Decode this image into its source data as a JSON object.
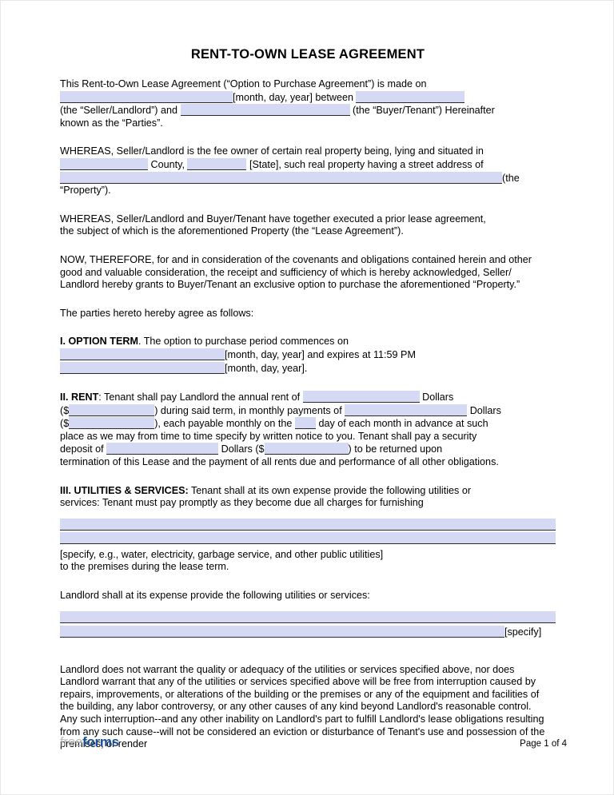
{
  "document": {
    "title": "RENT-TO-OWN LEASE AGREEMENT",
    "intro": {
      "line1": "This Rent-to-Own Lease Agreement (“Option to Purchase Agreement”) is made on",
      "date_label": "[month, day, year] between",
      "seller_label": "(the “Seller/Landlord”) and",
      "buyer_label": "(the “Buyer/Tenant”) Hereinafter",
      "line4": "known as the “Parties”."
    },
    "whereas1": {
      "line1": "WHEREAS, Seller/Landlord is the fee owner of certain real property being, lying and situated in",
      "county_label": "County,",
      "state_label": "[State], such real property having a street address of",
      "property_label": "(the “Property”)."
    },
    "whereas2": {
      "line1": "WHEREAS, Seller/Landlord and Buyer/Tenant have together executed a prior lease agreement,",
      "line2": "the subject of which is the aforementioned Property (the “Lease Agreement”)."
    },
    "now_therefore": {
      "text": "NOW, THEREFORE, for and in consideration of the covenants and obligations contained herein and other good and valuable consideration, the receipt and sufficiency of which is hereby acknowledged, Seller/ Landlord hereby grants to Buyer/Tenant an exclusive option to purchase the aforementioned “Property.”"
    },
    "agree_line": "The parties hereto hereby agree as follows:",
    "section_1": {
      "heading": "I. OPTION TERM",
      "text_after_heading": ". The option to purchase period commences on",
      "commence_label": "[month, day, year] and expires at 11:59 PM",
      "expire_label": "[month, day, year]."
    },
    "section_2": {
      "heading": "II.  RENT",
      "t1": ": Tenant shall pay Landlord the annual rent of",
      "t2": "Dollars",
      "t3": "($",
      "t4": ") during said term, in monthly payments of",
      "t5": "Dollars",
      "t6": "($",
      "t7": "), each payable monthly on the",
      "t8": "day of each month in advance at such",
      "t9": "place as we may from time to time specify by written notice to you. Tenant shall pay a security",
      "t10": "deposit of",
      "t11": "Dollars ($",
      "t12": ") to be returned upon",
      "t13": "termination of this Lease and the payment of all rents due and performance of all other obligations."
    },
    "section_3": {
      "heading": "III.  UTILITIES & SERVICES:",
      "t1": " Tenant shall at its own expense provide the following utilities or",
      "t2": "services: Tenant must pay promptly as they become due all charges for furnishing",
      "specify_note": "[specify, e.g., water, electricity, garbage service, and other public utilities]",
      "premises_note": "to the premises during the lease term.",
      "landlord_line": "Landlord shall at its expense provide the following utilities or services:",
      "specify_tag": "[specify]"
    },
    "warranty_paragraph": "Landlord does not warrant the quality or adequacy of the utilities or services specified above, nor does Landlord warrant that any of the utilities or services specified above will be free from interruption caused by repairs, improvements, or alterations of the building or the premises or any of the equipment and facilities of the building, any labor controversy, or any other causes of any kind beyond Landlord's reasonable control. Any such interruption--and any other inability on Landlord's part to fulfill Landlord's lease obligations resulting from any such cause--will not be considered an eviction or disturbance of Tenant's use and possession of the premises, or render"
  },
  "footer": {
    "logo_part1": "free",
    "logo_part2": "forms",
    "page_label": "Page 1 of 4"
  },
  "fields": {
    "date_made_on": "",
    "seller_name": "",
    "buyer_name": "",
    "county": "",
    "state": "",
    "street_address": "",
    "option_commence_date": "",
    "option_expire_date": "",
    "annual_rent_words": "",
    "annual_rent_amount": "",
    "monthly_rent_words": "",
    "monthly_rent_amount": "",
    "due_day": "",
    "security_deposit_words": "",
    "security_deposit_amount": "",
    "tenant_utilities_line1": "",
    "tenant_utilities_line2": "",
    "landlord_utilities_line1": "",
    "landlord_utilities_line2": ""
  },
  "colors": {
    "field_fill": "#d6d9f3",
    "field_underline": "#2a2a2a",
    "logo_gray": "#b9b9b9",
    "logo_blue": "#1b4f9c",
    "text": "#000000"
  }
}
